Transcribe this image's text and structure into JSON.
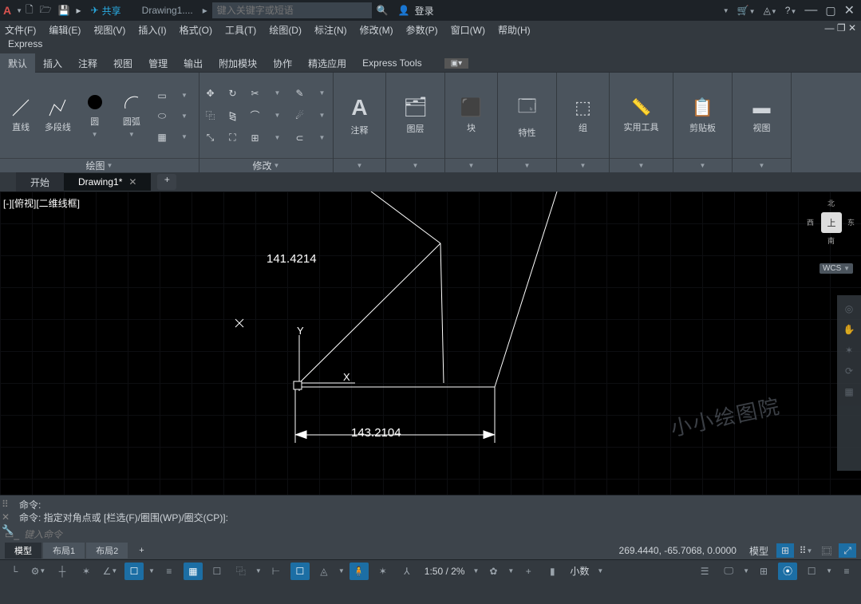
{
  "titlebar": {
    "share": "共享",
    "docname": "Drawing1....",
    "search_placeholder": "键入关键字或短语",
    "login": "登录"
  },
  "menu": {
    "file": "文件(F)",
    "edit": "编辑(E)",
    "view": "视图(V)",
    "insert": "插入(I)",
    "format": "格式(O)",
    "tools": "工具(T)",
    "draw": "绘图(D)",
    "dim": "标注(N)",
    "modify": "修改(M)",
    "param": "参数(P)",
    "window": "窗口(W)",
    "help": "帮助(H)"
  },
  "express": "Express",
  "ribbon_tabs": {
    "default": "默认",
    "insert": "插入",
    "annotate": "注释",
    "view": "视图",
    "manage": "管理",
    "output": "输出",
    "addins": "附加模块",
    "collab": "协作",
    "featured": "精选应用",
    "et": "Express Tools"
  },
  "draw_panel": {
    "line": "直线",
    "pline": "多段线",
    "circle": "圆",
    "arc": "圆弧",
    "label": "绘图"
  },
  "modify_panel": {
    "label": "修改"
  },
  "panels": {
    "annotate": "注释",
    "layers": "图层",
    "block": "块",
    "props": "特性",
    "group": "组",
    "util": "实用工具",
    "clip": "剪贴板",
    "view": "视图"
  },
  "doctabs": {
    "start": "开始",
    "d1": "Drawing1*"
  },
  "viewport": {
    "label": "[-][俯视][二维线框]",
    "wcs": "WCS",
    "cube": "上",
    "n": "北",
    "s": "南",
    "e": "东",
    "w": "西"
  },
  "dims": {
    "d1": "141.4214",
    "d2": "143.2104"
  },
  "axes": {
    "x": "X",
    "y": "Y"
  },
  "watermark": "小小绘图院",
  "cmd": {
    "l1": "命令:",
    "l2": "命令: 指定对角点或 [栏选(F)/圈围(WP)/圈交(CP)]:",
    "placeholder": "键入命令"
  },
  "layout": {
    "model": "模型",
    "l1": "布局1",
    "l2": "布局2",
    "model2": "模型"
  },
  "coords": "269.4440, -65.7068, 0.0000",
  "status": {
    "scale": "1:50 / 2%",
    "decimal": "小数"
  }
}
